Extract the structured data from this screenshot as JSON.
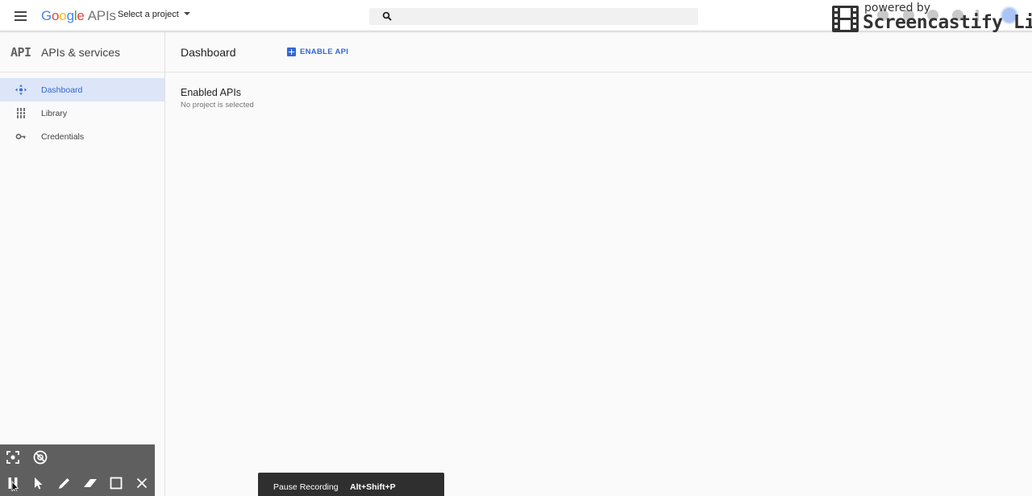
{
  "topbar": {
    "logo_letters": [
      "G",
      "o",
      "o",
      "g",
      "l",
      "e"
    ],
    "logo_suffix": "APIs",
    "project_select": "Select a project",
    "search_placeholder": ""
  },
  "watermark": {
    "small": "powered by",
    "big": "Screencastify Lite"
  },
  "sidebar": {
    "mark": "API",
    "title": "APIs & services",
    "items": [
      {
        "label": "Dashboard",
        "icon": "dashboard-icon",
        "active": true
      },
      {
        "label": "Library",
        "icon": "library-icon",
        "active": false
      },
      {
        "label": "Credentials",
        "icon": "key-icon",
        "active": false
      }
    ]
  },
  "main": {
    "title": "Dashboard",
    "enable_api_label": "ENABLE API",
    "section_title": "Enabled APIs",
    "section_subtitle": "No project is selected"
  },
  "recorder": {
    "tooltip_label": "Pause Recording",
    "tooltip_shortcut": "Alt+Shift+P",
    "tools": [
      "focus-icon",
      "webcam-icon",
      "pause-icon",
      "cursor-icon",
      "pen-icon",
      "eraser-icon",
      "rectangle-icon",
      "close-icon"
    ]
  },
  "colors": {
    "accent": "#3367d6",
    "active_bg": "#dce6f8",
    "toolbar_bg": "#5f5f5f"
  }
}
